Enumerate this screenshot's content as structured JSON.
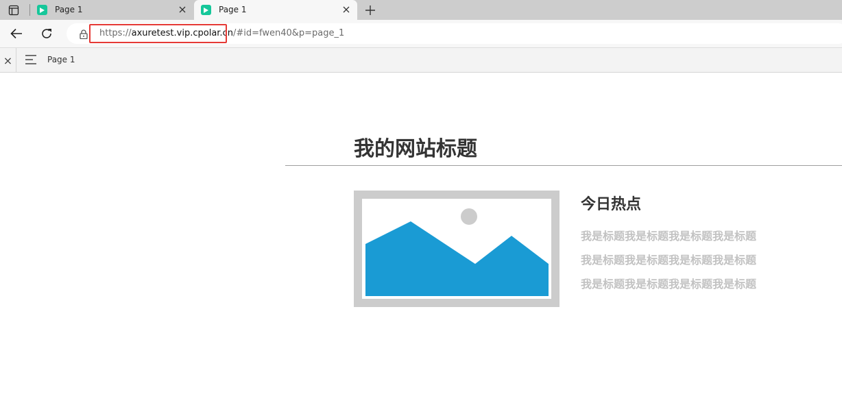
{
  "browser": {
    "tabs": [
      {
        "title": "Page 1",
        "active": false
      },
      {
        "title": "Page 1",
        "active": true
      }
    ],
    "url": {
      "scheme": "https://",
      "host": "axuretest.vip.cpolar.cn",
      "rest": "/#id=fwen40&p=page_1"
    },
    "icons": {
      "tab_actions": "tab-actions-icon",
      "favicon": "play-favicon-icon",
      "close": "close-icon",
      "new_tab": "plus-icon",
      "back": "back-arrow-icon",
      "reload": "reload-icon",
      "lock": "lock-icon"
    },
    "highlight_color": "#e53935",
    "favicon_color": "#16c79a"
  },
  "axure_bar": {
    "page_label": "Page 1",
    "close_glyph": "×",
    "menu_icon": "hamburger-icon"
  },
  "content": {
    "site_title": "我的网站标题",
    "section_title": "今日热点",
    "lines": [
      "我是标题我是标题我是标题我是标题",
      "我是标题我是标题我是标题我是标题",
      "我是标题我是标题我是标题我是标题"
    ],
    "image_placeholder": {
      "frame_color": "#cccccc",
      "mountain_color": "#1a9bd4",
      "sun_color": "#cccccc"
    },
    "colors": {
      "title": "#333333",
      "line_text": "#c2c2c2",
      "rule": "#9e9e9e"
    }
  }
}
